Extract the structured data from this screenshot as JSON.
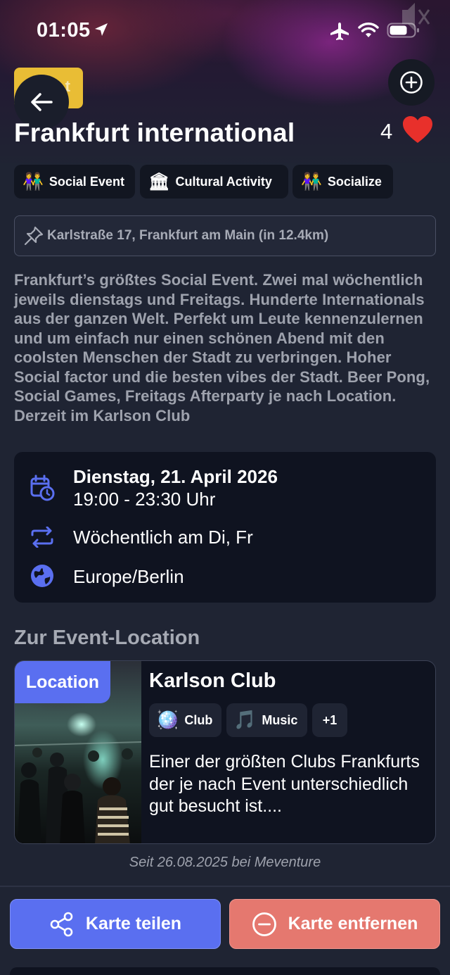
{
  "status_bar": {
    "time": "01:05"
  },
  "header": {
    "yellow_tag_text": "t",
    "title": "Frankfurt international",
    "like_count": "4"
  },
  "tags": [
    {
      "emoji": "👫",
      "label": "Social Event"
    },
    {
      "emoji": "🏛",
      "label": "Cultural Activity"
    },
    {
      "emoji": "👫",
      "label": "Socialize"
    }
  ],
  "address": "Karlstraße 17, Frankfurt am Main (in 12.4km)",
  "description": "Frankfurt’s größtes Social Event. Zwei mal wöchentlich jeweils dienstags und Freitags. Hunderte Internationals aus der ganzen Welt. Perfekt um Leute kennenzulernen und um einfach nur einen schönen Abend mit den coolsten Menschen der Stadt zu verbringen. Hoher Social factor und die besten vibes der Stadt. Beer Pong, Social Games, Freitags Afterparty je nach Location. Derzeit im Karlson Club",
  "schedule": {
    "date": "Dienstag, 21. April 2026",
    "time": "19:00 - 23:30 Uhr",
    "recurrence": "Wöchentlich am Di, Fr",
    "timezone": "Europe/Berlin"
  },
  "location_section": {
    "title": "Zur Event-Location",
    "badge": "Location",
    "name": "Karlson Club",
    "chips": [
      {
        "emoji": "🪩",
        "label": "Club"
      },
      {
        "emoji": "🎵",
        "label": "Music"
      },
      {
        "emoji": "",
        "label": "+1"
      }
    ],
    "description": "Einer der größten Clubs Frankfurts der je nach Event unterschiedlich gut besucht ist...."
  },
  "since_text": "Seit 26.08.2025 bei Meventure",
  "actions": {
    "share_label": "Karte teilen",
    "remove_label": "Karte entfernen"
  },
  "colors": {
    "background": "#1f2433",
    "card": "#0f1320",
    "accent": "#5a6ff0",
    "danger": "#e5786f",
    "heart": "#e8302b",
    "tag_yellow": "#e9bd35"
  }
}
